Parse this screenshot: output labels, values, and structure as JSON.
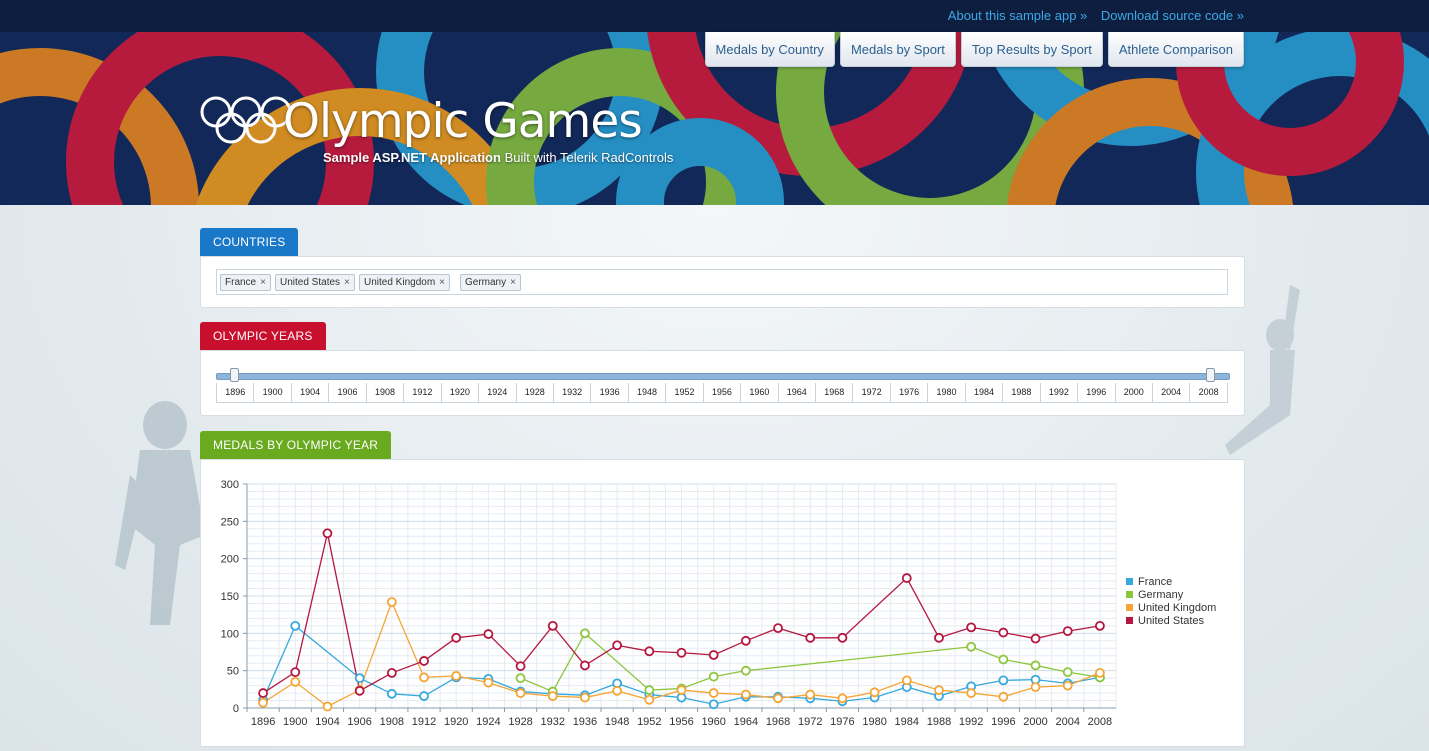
{
  "header": {
    "links": [
      "About this sample app »",
      "Download source code »"
    ],
    "nav": [
      "Medals by Country",
      "Medals by Sport",
      "Top Results by Sport",
      "Athlete Comparison"
    ],
    "title": "Olympic Games",
    "subtitle_bold": "Sample ASP.NET Application",
    "subtitle_rest": "Built with Telerik RadControls"
  },
  "countries": {
    "label": "COUNTRIES",
    "tokens": [
      "France",
      "United States",
      "United Kingdom",
      "Germany"
    ],
    "remove_glyph": "×"
  },
  "years": {
    "label": "OLYMPIC YEARS",
    "ticks": [
      "1896",
      "1900",
      "1904",
      "1906",
      "1908",
      "1912",
      "1920",
      "1924",
      "1928",
      "1932",
      "1936",
      "1948",
      "1952",
      "1956",
      "1960",
      "1964",
      "1968",
      "1972",
      "1976",
      "1980",
      "1984",
      "1988",
      "1992",
      "1996",
      "2000",
      "2004",
      "2008"
    ],
    "range_start": "1896",
    "range_end": "2008"
  },
  "medals": {
    "label": "MEDALS BY OLYMPIC YEAR"
  },
  "colors": {
    "countries_tab": "#1a78c8",
    "years_tab": "#c8102e",
    "medals_tab": "#6aaa1e",
    "france": "#37a8dd",
    "germany": "#8cc63f",
    "uk": "#f5a535",
    "usa": "#b5163f"
  },
  "chart_data": {
    "type": "line",
    "categories": [
      "1896",
      "1900",
      "1904",
      "1906",
      "1908",
      "1912",
      "1920",
      "1924",
      "1928",
      "1932",
      "1936",
      "1948",
      "1952",
      "1956",
      "1960",
      "1964",
      "1968",
      "1972",
      "1976",
      "1980",
      "1984",
      "1988",
      "1992",
      "1996",
      "2000",
      "2004",
      "2008"
    ],
    "ylim": [
      0,
      300
    ],
    "yticks": [
      0,
      50,
      100,
      150,
      200,
      250,
      300
    ],
    "legend_position": "right",
    "grid": true,
    "series": [
      {
        "name": "France",
        "color": "#37a8dd",
        "values": [
          11,
          110,
          null,
          40,
          19,
          16,
          41,
          39,
          22,
          19,
          17,
          33,
          18,
          14,
          5,
          15,
          15,
          13,
          9,
          14,
          28,
          16,
          29,
          37,
          38,
          33,
          41
        ]
      },
      {
        "name": "Germany",
        "color": "#8cc63f",
        "values": [
          null,
          null,
          null,
          null,
          null,
          null,
          null,
          null,
          40,
          22,
          100,
          null,
          24,
          26,
          42,
          50,
          null,
          null,
          null,
          null,
          null,
          null,
          82,
          65,
          57,
          48,
          41
        ]
      },
      {
        "name": "United Kingdom",
        "color": "#f5a535",
        "values": [
          7,
          35,
          2,
          24,
          142,
          41,
          43,
          34,
          20,
          16,
          14,
          23,
          11,
          24,
          20,
          18,
          13,
          18,
          13,
          21,
          37,
          24,
          20,
          15,
          28,
          30,
          47
        ]
      },
      {
        "name": "United States",
        "color": "#b5163f",
        "values": [
          20,
          48,
          234,
          23,
          47,
          63,
          94,
          99,
          56,
          110,
          57,
          84,
          76,
          74,
          71,
          90,
          107,
          94,
          94,
          null,
          174,
          94,
          108,
          101,
          93,
          103,
          110
        ]
      }
    ]
  }
}
